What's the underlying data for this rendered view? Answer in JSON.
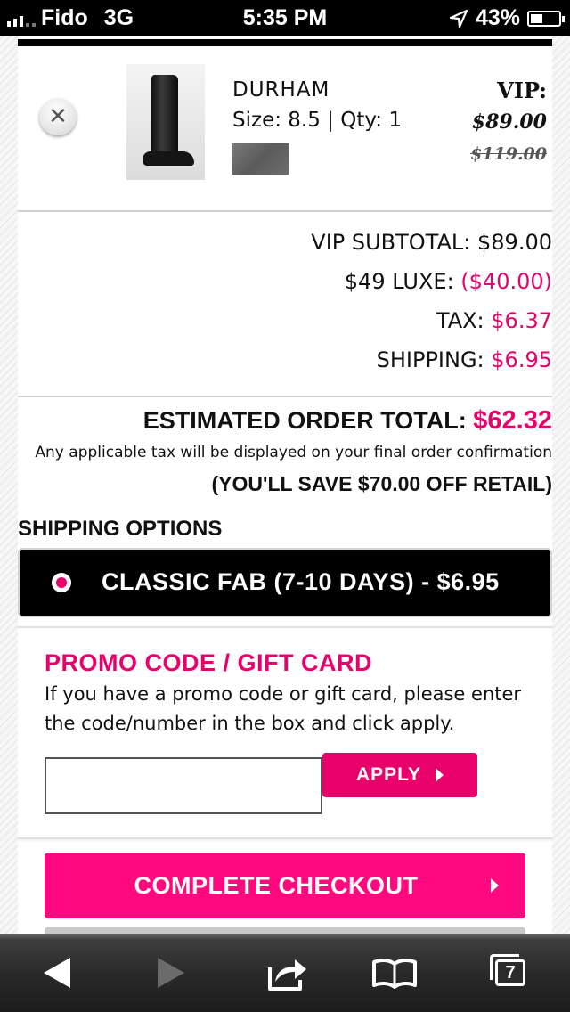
{
  "status_bar": {
    "carrier": "Fido",
    "network": "3G",
    "time": "5:35 PM",
    "battery": "43%",
    "battery_level": 0.43
  },
  "cart_item": {
    "name": "DURHAM",
    "meta": "Size: 8.5 | Qty: 1",
    "vip_label": "VIP:",
    "vip_price": "$89.00",
    "retail_price": "$119.00"
  },
  "summary": {
    "vip_subtotal_label": "VIP SUBTOTAL:",
    "vip_subtotal_value": "$89.00",
    "luxe_label": "$49 LUXE:",
    "luxe_value": "($40.00)",
    "tax_label": "TAX:",
    "tax_value": "$6.37",
    "shipping_label": "SHIPPING:",
    "shipping_value": "$6.95",
    "total_label": "ESTIMATED ORDER TOTAL:",
    "total_value": "$62.32",
    "tax_note": "Any applicable tax will be displayed on your final order confirmation",
    "savings": "(YOU'LL SAVE $70.00 OFF RETAIL)"
  },
  "shipping": {
    "title": "SHIPPING OPTIONS",
    "selected_option": "CLASSIC FAB (7-10 DAYS) - $6.95"
  },
  "promo": {
    "title": "PROMO CODE / GIFT CARD",
    "description": "If you have a promo code or gift card, please enter the code/number in the box and click apply.",
    "input_value": "",
    "apply_label": "APPLY"
  },
  "checkout": {
    "label": "COMPLETE CHECKOUT"
  },
  "browser_toolbar": {
    "tabs_count": "7"
  },
  "colors": {
    "accent": "#e8006b",
    "checkout": "#ff0a7e"
  },
  "icons": [
    "remove-icon",
    "location-arrow-icon",
    "battery-icon",
    "back-icon",
    "forward-icon",
    "share-icon",
    "bookmarks-icon",
    "tabs-icon"
  ]
}
